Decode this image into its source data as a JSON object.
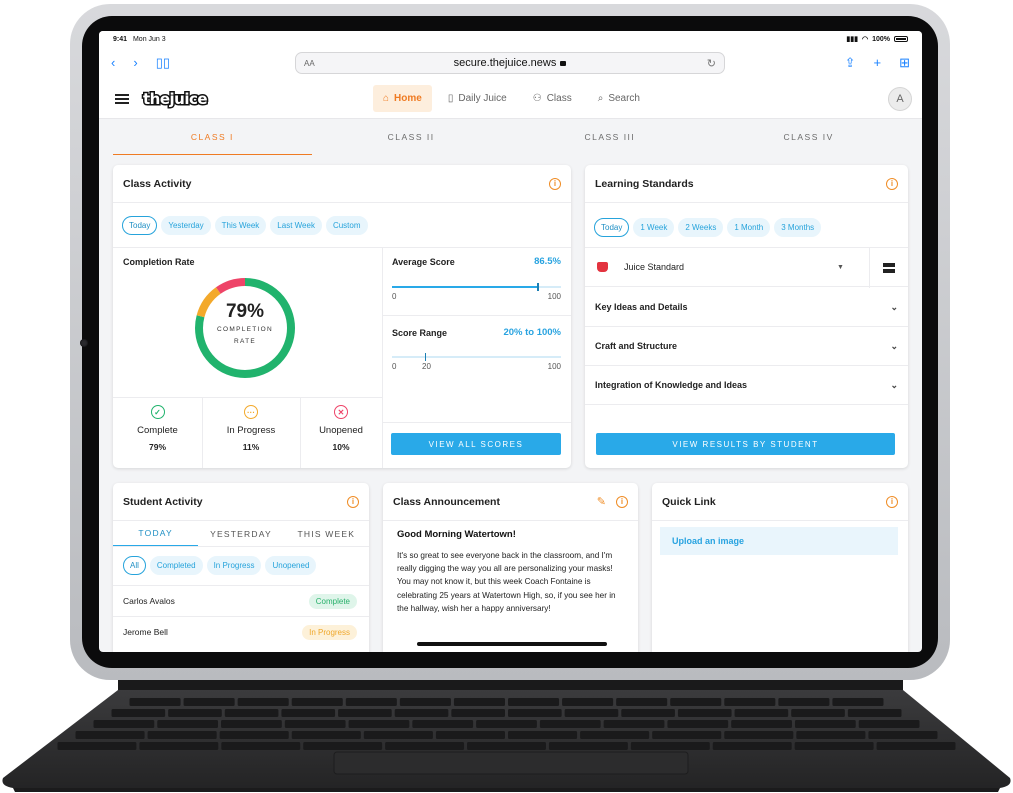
{
  "status_bar": {
    "time": "9:41",
    "date": "Mon Jun 3",
    "battery": "100%"
  },
  "browser": {
    "text_size": "AA",
    "url": "secure.thejuice.news"
  },
  "brand": {
    "logo_text": "thejuice",
    "accent": "#ef7b23",
    "blue": "#29a9e8"
  },
  "nav": {
    "items": [
      {
        "label": "Home",
        "icon": "home-icon",
        "active": true
      },
      {
        "label": "Daily Juice",
        "icon": "juice-cup-icon"
      },
      {
        "label": "Class",
        "icon": "people-icon"
      },
      {
        "label": "Search",
        "icon": "search-icon"
      }
    ],
    "avatar_initial": "A"
  },
  "class_tabs": [
    "CLASS I",
    "CLASS II",
    "CLASS III",
    "CLASS IV"
  ],
  "class_activity": {
    "title": "Class Activity",
    "filters": [
      "Today",
      "Yesterday",
      "This Week",
      "Last Week",
      "Custom"
    ],
    "completion": {
      "label": "Completion Rate",
      "percent_text": "79%",
      "caption_line1": "COMPLETION",
      "caption_line2": "RATE",
      "segments": [
        {
          "name": "Complete",
          "value": 79,
          "color": "#21b36d"
        },
        {
          "name": "In Progress",
          "value": 11,
          "color": "#f3a92b"
        },
        {
          "name": "Unopened",
          "value": 10,
          "color": "#ee4468"
        }
      ]
    },
    "stats": [
      {
        "label": "Complete",
        "value": "79%",
        "icon": "check-circle-icon",
        "color": "#21b36d"
      },
      {
        "label": "In Progress",
        "value": "11%",
        "icon": "ellipsis-circle-icon",
        "color": "#f3a92b"
      },
      {
        "label": "Unopened",
        "value": "10%",
        "icon": "x-circle-icon",
        "color": "#ee4468"
      }
    ],
    "average_score": {
      "label": "Average Score",
      "value": "86.5%",
      "min": "0",
      "max": "100",
      "fraction": 0.865
    },
    "score_range": {
      "label": "Score Range",
      "value": "20% to 100%",
      "min": "0",
      "mid": "20",
      "max": "100",
      "from": 0.2,
      "to": 1.0
    },
    "button": "VIEW ALL SCORES"
  },
  "learning_standards": {
    "title": "Learning Standards",
    "filters": [
      "Today",
      "1 Week",
      "2 Weeks",
      "1 Month",
      "3 Months"
    ],
    "selector": "Juice Standard",
    "sections": [
      "Key Ideas and Details",
      "Craft and Structure",
      "Integration of Knowledge and Ideas"
    ],
    "button": "VIEW RESULTS BY STUDENT"
  },
  "student_activity": {
    "title": "Student Activity",
    "tabs": [
      "TODAY",
      "YESTERDAY",
      "THIS WEEK"
    ],
    "filters": [
      "All",
      "Completed",
      "In Progress",
      "Unopened"
    ],
    "students": [
      {
        "name": "Carlos Avalos",
        "status": "Complete"
      },
      {
        "name": "Jerome Bell",
        "status": "In Progress"
      }
    ]
  },
  "announcement": {
    "title": "Class Announcement",
    "heading": "Good Morning Watertown!",
    "body": "It's so great to see everyone back in the classroom, and I'm really digging the way you all are personalizing your masks! You may not know it, but this week Coach Fontaine is celebrating 25 years at Watertown High, so, if you see her in the hallway, wish her a happy anniversary!"
  },
  "quick_link": {
    "title": "Quick Link",
    "link": "Upload an image"
  }
}
